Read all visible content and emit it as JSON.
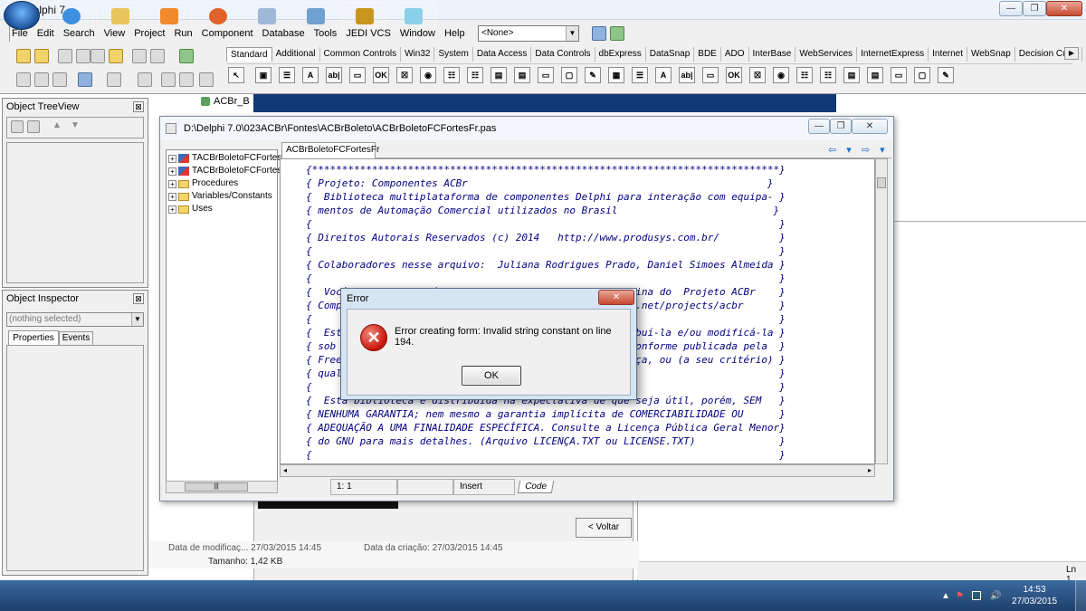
{
  "main_window": {
    "title": "Delphi 7",
    "minimize_glyph": "—",
    "restore_glyph": "❐",
    "close_glyph": "✕"
  },
  "menu": [
    "File",
    "Edit",
    "Search",
    "View",
    "Project",
    "Run",
    "Component",
    "Database",
    "Tools",
    "JEDI VCS",
    "Window",
    "Help"
  ],
  "config_combo": {
    "value": "<None>",
    "arrow": "▼"
  },
  "palette": {
    "tabs": [
      "Standard",
      "Additional",
      "Common Controls",
      "Win32",
      "System",
      "Data Access",
      "Data Controls",
      "dbExpress",
      "DataSnap",
      "BDE",
      "ADO",
      "InterBase",
      "WebServices",
      "InternetExpress",
      "Internet",
      "WebSnap",
      "Decision Cube"
    ],
    "active_tab": "Standard",
    "scroll_arrow": "▶",
    "components": [
      "↖",
      "▣",
      "☰",
      "A",
      "ab|",
      "▭",
      "OK",
      "☒",
      "◉",
      "☷",
      "☷",
      "▤",
      "▤",
      "▭",
      "▢",
      "✎",
      "▦",
      "☰",
      "A",
      "ab|",
      "▭",
      "OK",
      "☒",
      "◉",
      "☷",
      "☷",
      "▤",
      "▤",
      "▭",
      "▢",
      "✎"
    ]
  },
  "tree_view_panel": {
    "title": "Object TreeView",
    "close_glyph": "⊠"
  },
  "inspector_panel": {
    "title": "Object Inspector",
    "close_glyph": "⊠",
    "selection": "(nothing selected)",
    "tabs": [
      "Properties",
      "Events"
    ]
  },
  "background": {
    "acbr_label": "ACBr_B",
    "voltar_button": "< Voltar",
    "info_modified": "Data de modificaç... 27/03/2015 14:45",
    "info_created": "Data da criação: 27/03/2015 14:45",
    "info_size": "Tamanho: 1,42 KB",
    "right_status": "Ln 1,"
  },
  "editor": {
    "title": "D:\\Delphi 7.0\\023ACBr\\Fontes\\ACBrBoleto\\ACBrBoletoFCFortesFr.pas",
    "file_tab": "ACBrBoletoFCFortesFr",
    "nav_arrows": "⇦ ▾ ⇨ ▾",
    "explorer_items": [
      {
        "type": "class",
        "label": "TACBrBoletoFCFortes"
      },
      {
        "type": "class",
        "label": "TACBrBoletoFCFortes"
      },
      {
        "type": "folder",
        "label": "Procedures"
      },
      {
        "type": "folder",
        "label": "Variables/Constants"
      },
      {
        "type": "folder",
        "label": "Uses"
      }
    ],
    "code_lines": [
      "{******************************************************************************}",
      "{ Projeto: Componentes ACBr                                                  }",
      "{  Biblioteca multiplataforma de componentes Delphi para interação com equipa- }",
      "{ mentos de Automação Comercial utilizados no Brasil                          }",
      "{                                                                              }",
      "{ Direitos Autorais Reservados (c) 2014   http://www.produsys.com.br/          }",
      "{                                                                              }",
      "{ Colaboradores nesse arquivo:  Juliana Rodrigues Prado, Daniel Simoes Almeida }",
      "{                                                                              }",
      "{  Você pode obter a última versão desse arquivo na pagina do  Projeto ACBr    }",
      "{ Componentes localizado em      http://www.sourceforge.net/projects/acbr      }",
      "{                                                                              }",
      "{  Esta biblioteca é software livre; você pode redistribuí-la e/ou modificá-la }",
      "{ sob os termos da Licença Pública Geral Menor do GNU conforme publicada pela  }",
      "{ Free Software Foundation; tanto a versão 2.1 da Licença, ou (a seu critério) }",
      "{ qualquer versão posterior.                                                   }",
      "{                                                                              }",
      "{  Esta biblioteca é distribuída na expectativa de que seja útil, porém, SEM   }",
      "{ NENHUMA GARANTIA; nem mesmo a garantia implícita de COMERCIABILIDADE OU      }",
      "{ ADEQUAÇÃO A UMA FINALIDADE ESPECÍFICA. Consulte a Licença Pública Geral Menor}",
      "{ do GNU para mais detalhes. (Arquivo LICENÇA.TXT ou LICENSE.TXT)              }",
      "{                                                                              }"
    ],
    "status_position": "1:   1",
    "status_mode": "Insert",
    "code_tab": "Code",
    "scroll_left": "◂",
    "scroll_right": "▸",
    "scroll_grip": "|||"
  },
  "dialog": {
    "title": "Error",
    "close_glyph": "✕",
    "icon_glyph": "✕",
    "message": "Error creating form: Invalid string constant on line 194.",
    "ok_label": "OK"
  },
  "taskbar": {
    "time": "14:53",
    "date": "27/03/2015",
    "tray_arrow": "▲",
    "volume_glyph": "🔊",
    "flag_glyph": "⚑"
  },
  "colors": {
    "accent": "#1d70c8",
    "code_comment": "#000080",
    "error_red": "#c8140a",
    "taskbar": "#1e3f6b"
  }
}
